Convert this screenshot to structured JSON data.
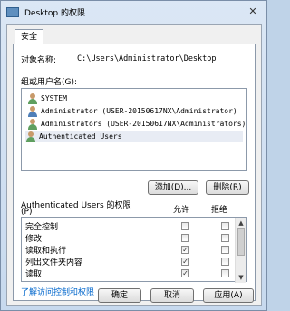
{
  "window": {
    "title": "Desktop 的权限",
    "close_glyph": "✕"
  },
  "tabs": [
    {
      "label": "安全"
    }
  ],
  "object": {
    "label": "对象名称:",
    "value": "C:\\Users\\Administrator\\Desktop"
  },
  "users": {
    "label": "组或用户名(G):",
    "items": [
      {
        "name": "SYSTEM",
        "icon": "group-icon"
      },
      {
        "name": "Administrator (USER-20150617NX\\Administrator)",
        "icon": "user-icon"
      },
      {
        "name": "Administrators (USER-20150617NX\\Administrators)",
        "icon": "group-icon"
      },
      {
        "name": "Authenticated Users",
        "icon": "group-icon",
        "selected": true
      }
    ]
  },
  "buttons": {
    "add": "添加(D)...",
    "remove": "删除(R)",
    "ok": "确定",
    "cancel": "取消",
    "apply": "应用(A)"
  },
  "permissions": {
    "label_line1": "Authenticated Users 的权限",
    "label_line2": "(P)",
    "allow_header": "允许",
    "deny_header": "拒绝",
    "rows": [
      {
        "name": "完全控制",
        "allow": false,
        "deny": false
      },
      {
        "name": "修改",
        "allow": false,
        "deny": false
      },
      {
        "name": "读取和执行",
        "allow": true,
        "deny": false
      },
      {
        "name": "列出文件夹内容",
        "allow": true,
        "deny": false
      },
      {
        "name": "读取",
        "allow": true,
        "deny": false
      }
    ]
  },
  "link": {
    "text": "了解访问控制和权限"
  }
}
